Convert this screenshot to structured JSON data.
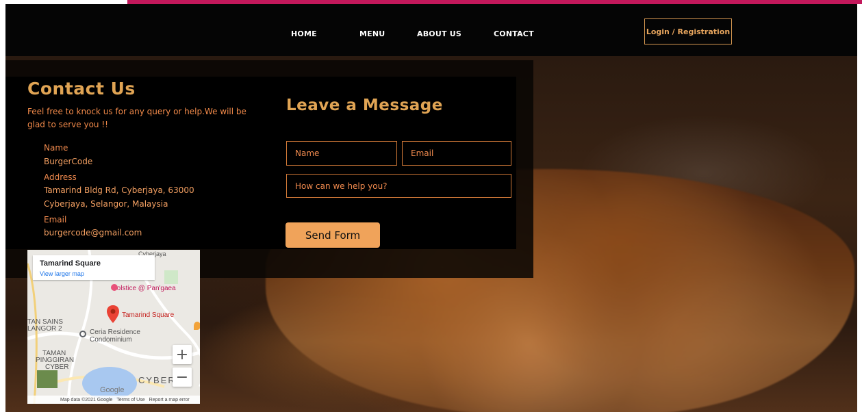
{
  "nav": {
    "items": [
      {
        "label": "HOME"
      },
      {
        "label": "MENU"
      },
      {
        "label": "ABOUT US"
      },
      {
        "label": "CONTACT"
      }
    ],
    "login_label": "Login / Registration"
  },
  "contact": {
    "title": "Contact Us",
    "description": "Feel free to knock us for any query or help.We will be glad to serve you !!",
    "name_label": "Name",
    "name_value": "BurgerCode",
    "address_label": "Address",
    "address_line1": "Tamarind Bldg Rd, Cyberjaya, 63000",
    "address_line2": "Cyberjaya, Selangor, Malaysia",
    "email_label": "Email",
    "email_value": "burgercode@gmail.com"
  },
  "form": {
    "title": "Leave a Message",
    "name_placeholder": "Name",
    "email_placeholder": "Email",
    "message_placeholder": "How can we help you?",
    "submit_label": "Send Form"
  },
  "map": {
    "place_title": "Tamarind Square",
    "larger_map_link": "View larger map",
    "labels": {
      "cyberjaya_top": "Cyberjaya",
      "solstice": "Solstice @ Pan'gaea",
      "tamarind_marker": "Tamarind Square",
      "taman_sains": "TAN SAINS",
      "langor": "LANGOR 2",
      "ceria_line1": "Ceria Residence",
      "ceria_line2": "Condominium",
      "taman_line1": "TAMAN",
      "taman_line2": "PINGGIRAN",
      "taman_line3": "CYBER",
      "cyberj": "CYBERJ",
      "google": "Google"
    },
    "zoom_in": "+",
    "zoom_out": "−",
    "footer": {
      "map_data": "Map data ©2021 Google",
      "terms": "Terms of Use",
      "report": "Report a map error"
    }
  },
  "colors": {
    "accent": "#e0a454",
    "accent_text": "#f08a4e",
    "button_bg": "#f0a35a",
    "nav_bg": "#050505",
    "top_strip": "#c2185b"
  }
}
